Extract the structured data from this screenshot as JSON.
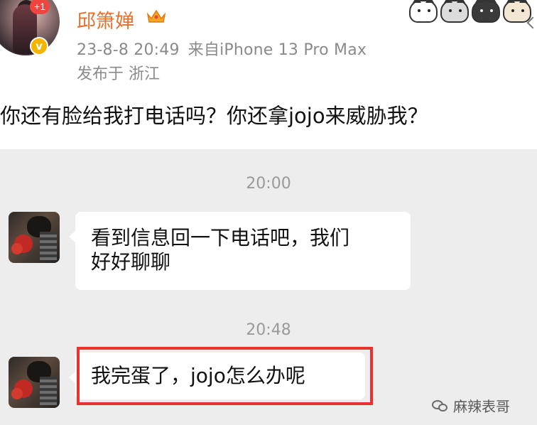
{
  "post": {
    "username": "邱箫婵",
    "notification_badge": "+1",
    "verified_mark": "v",
    "date_time": "23-8-8 20:49",
    "device": "来自iPhone 13 Pro Max",
    "location": "发布于 浙江",
    "text": "你还有脸给我打电话吗？你还拿jojo来威胁我？",
    "icons": [
      "crown-icon",
      "verified-icon",
      "cat-sticker-icon"
    ],
    "colors": {
      "username": "#e8702a",
      "badge": "#f0453c",
      "verified": "#f6b400"
    }
  },
  "chat": {
    "messages": [
      {
        "time": "20:00",
        "text_line1": "看到信息回一下电话吧，我们",
        "text_line2": "好好聊聊"
      },
      {
        "time": "20:48",
        "text": "我完蛋了，jojo怎么办呢"
      }
    ],
    "highlight_color": "#e6332f",
    "background": "#ededed"
  },
  "watermark": {
    "text": "麻辣表哥",
    "icon": "wechat-icon"
  }
}
